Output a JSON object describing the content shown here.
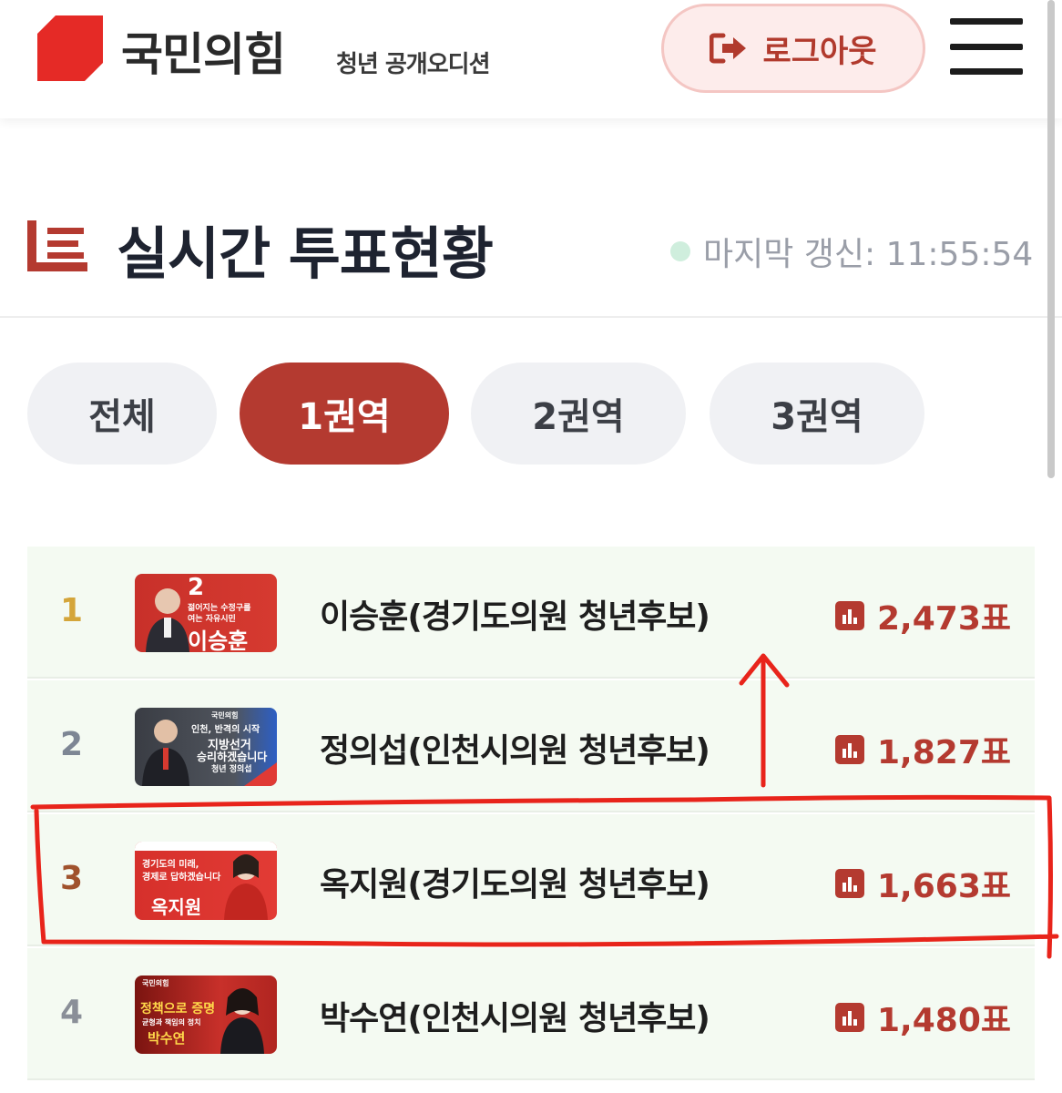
{
  "header": {
    "brand": "국민의힘",
    "subtitle": "청년 공개오디션",
    "logout_label": "로그아웃",
    "logout_icon": "sign-out-icon",
    "menu_icon": "hamburger-menu-icon"
  },
  "section": {
    "title": "실시간 투표현황",
    "last_updated": "마지막 갱신: 11:55:54",
    "status_color": "#cfeedd"
  },
  "tabs": [
    {
      "label": "전체",
      "active": false
    },
    {
      "label": "1권역",
      "active": true
    },
    {
      "label": "2권역",
      "active": false
    },
    {
      "label": "3권역",
      "active": false
    }
  ],
  "candidates": [
    {
      "rank": "1",
      "rank_color": "#d4a53a",
      "name": "이승훈(경기도의원 청년후보)",
      "votes": "2,473표",
      "thumb": {
        "line1": "2",
        "line2": "젊어지는 수정구를",
        "line3": "여는 자유시민",
        "line4": "이승훈"
      }
    },
    {
      "rank": "2",
      "rank_color": "#7d8694",
      "name": "정의섭(인천시의원 청년후보)",
      "votes": "1,827표",
      "thumb": {
        "line1": "국민의힘",
        "line2": "인천, 반격의 시작",
        "line3": "지방선거",
        "line4": "승리하겠습니다",
        "line5": "청년 정의섭"
      }
    },
    {
      "rank": "3",
      "rank_color": "#a0522d",
      "name": "옥지원(경기도의원 청년후보)",
      "votes": "1,663표",
      "thumb": {
        "line1": "경기도의 미래,",
        "line2": "경제로 답하겠습니다",
        "line3": "옥지원"
      }
    },
    {
      "rank": "4",
      "rank_color": "#8a8f98",
      "name": "박수연(인천시의원 청년후보)",
      "votes": "1,480표",
      "thumb": {
        "line1": "국민의힘",
        "line2": "정책으로 증명",
        "line3": "균형과 책임의 정치",
        "line4": "박수연"
      }
    }
  ],
  "colors": {
    "accent": "#b43a30",
    "row_bg": "#f4faf2",
    "annotation": "#e8241b"
  }
}
